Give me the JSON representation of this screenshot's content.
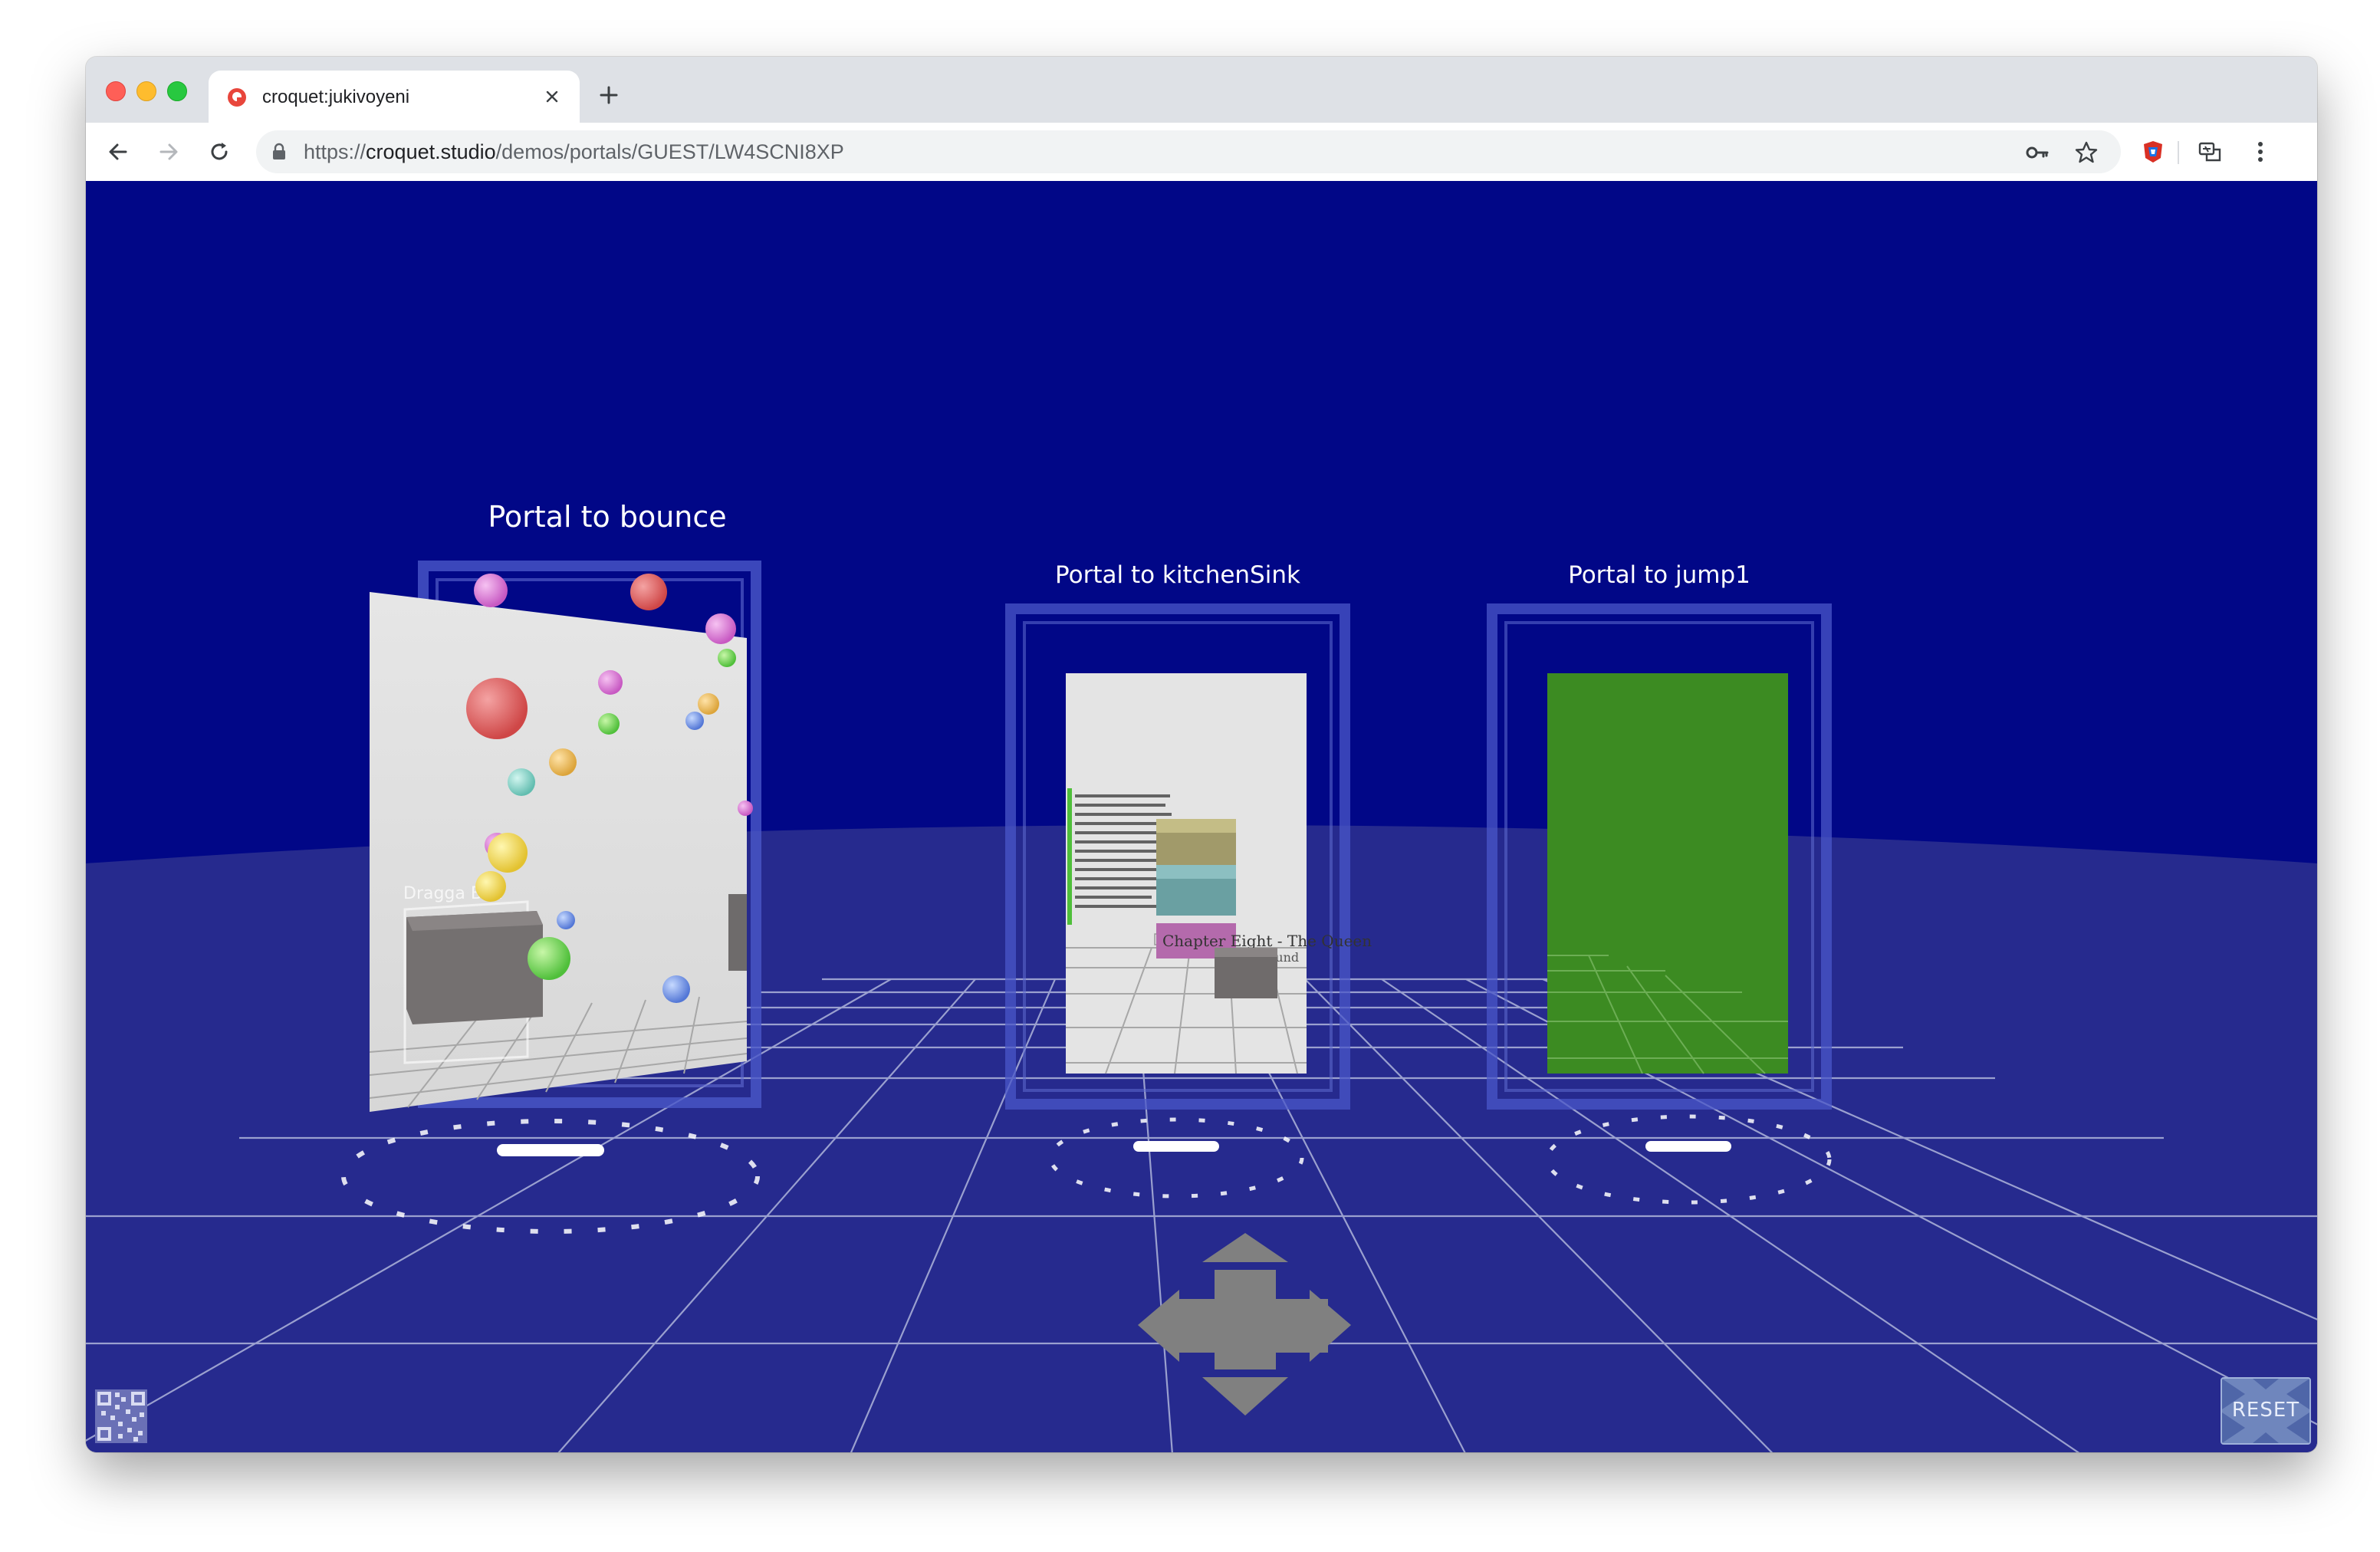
{
  "browser": {
    "tab": {
      "title": "croquet:jukivoyeni",
      "favicon": "croquet-logo-icon"
    },
    "url": {
      "scheme": "https://",
      "host": "croquet.studio",
      "path": "/demos/portals/GUEST/LW4SCNI8XP"
    },
    "toolbar_icons": [
      "back-arrow-icon",
      "forward-arrow-icon",
      "reload-icon",
      "lock-icon",
      "key-icon",
      "star-icon",
      "extension-icon",
      "translate-icon",
      "menu-kebab-icon"
    ]
  },
  "scene": {
    "sky_color": "#010787",
    "floor_color": "#262a8e",
    "portals": [
      {
        "label": "Portal to bounce"
      },
      {
        "label": "Portal to kitchenSink",
        "inner_title": "Chapter Eight - The Queen",
        "inner_bg_word": "round"
      },
      {
        "label": "Portal to jump1"
      }
    ],
    "bounce_panel_text": "Dragga   Box",
    "reset_label": "RESET"
  }
}
